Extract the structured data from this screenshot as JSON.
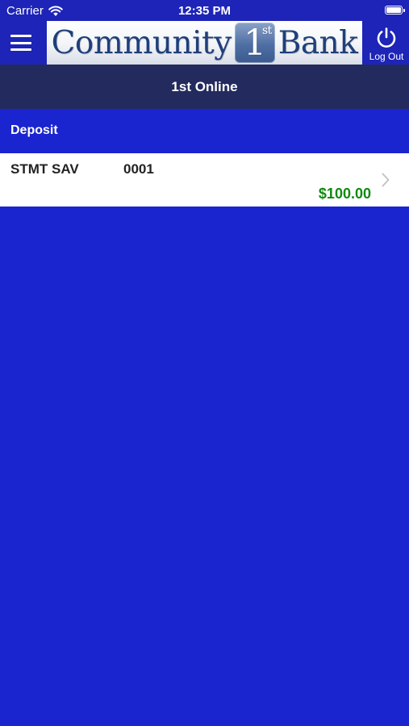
{
  "status_bar": {
    "carrier": "Carrier",
    "time": "12:35 PM"
  },
  "header": {
    "menu_icon": "hamburger-menu-icon",
    "logo": {
      "word1": "Community",
      "badge_number": "1",
      "badge_suffix": "st",
      "word2": "Bank"
    },
    "logout_label": "Log Out",
    "logout_icon": "power-icon"
  },
  "title_bar": {
    "title": "1st Online"
  },
  "sections": [
    {
      "label": "Deposit",
      "accounts": [
        {
          "name": "STMT SAV",
          "number": "0001",
          "balance": "$100.00"
        }
      ]
    }
  ],
  "colors": {
    "background": "#1a24cf",
    "header": "#1d24b7",
    "title_bar": "#232a5e",
    "balance": "#108a10"
  }
}
